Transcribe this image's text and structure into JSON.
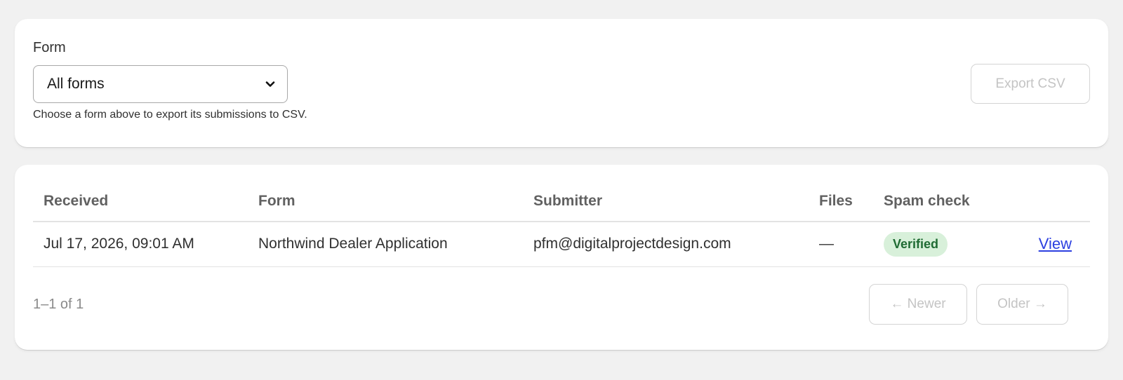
{
  "filter": {
    "label": "Form",
    "selected": "All forms",
    "help": "Choose a form above to export its submissions to CSV.",
    "export_label": "Export CSV"
  },
  "table": {
    "columns": [
      "Received",
      "Form",
      "Submitter",
      "Files",
      "Spam check"
    ],
    "rows": [
      {
        "received": "Jul 17, 2026, 09:01 AM",
        "form": "Northwind Dealer Application",
        "submitter": "pfm@digitalprojectdesign.com",
        "files": "—",
        "spam_check": "Verified",
        "action": "View"
      }
    ]
  },
  "pagination": {
    "range": "1–1 of 1",
    "newer_label": "← Newer",
    "older_label": "Older →"
  },
  "colors": {
    "page_bg": "#f1f1f1",
    "badge_bg": "#d8f0da",
    "badge_text": "#1f6b33",
    "link": "#2c40e0",
    "disabled_text": "#c4c4c4"
  },
  "icons": {
    "select_arrow": "chevron-down-icon"
  }
}
